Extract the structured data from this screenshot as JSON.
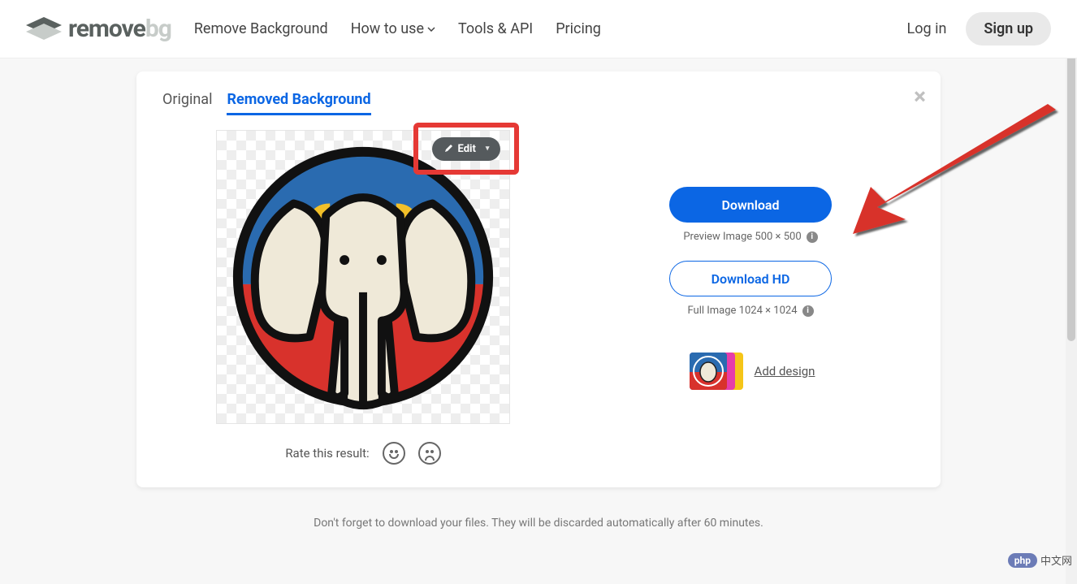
{
  "brand": {
    "name_a": "remove",
    "name_b": "bg"
  },
  "nav": {
    "remove_bg": "Remove Background",
    "how_to": "How to use",
    "tools_api": "Tools & API",
    "pricing": "Pricing",
    "login": "Log in",
    "signup": "Sign up"
  },
  "tabs": {
    "original": "Original",
    "removed": "Removed Background"
  },
  "edit": {
    "label": "Edit"
  },
  "rate": {
    "label": "Rate this result:"
  },
  "actions": {
    "download": "Download",
    "preview_text": "Preview Image 500 × 500",
    "download_hd": "Download HD",
    "full_text": "Full Image 1024 × 1024",
    "add_design": "Add design"
  },
  "note": "Don't forget to download your files. They will be discarded automatically after 60 minutes.",
  "watermark": {
    "php": "php",
    "cn": "中文网"
  }
}
